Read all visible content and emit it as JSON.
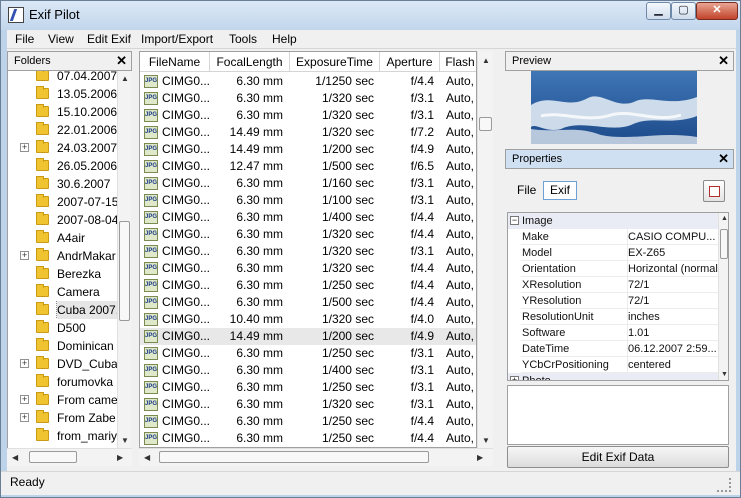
{
  "window": {
    "title": "Exif Pilot",
    "controls": [
      "minimize",
      "maximize",
      "close"
    ]
  },
  "menu": [
    {
      "label": "File"
    },
    {
      "label": "View"
    },
    {
      "label": "Edit Exif"
    },
    {
      "label": "Import/Export"
    },
    {
      "label": "Tools"
    },
    {
      "label": "Help"
    }
  ],
  "folders": {
    "title": "Folders",
    "close_label": "✕",
    "items": [
      {
        "label": "07.04.2007",
        "expander": false
      },
      {
        "label": "13.05.2006",
        "expander": false
      },
      {
        "label": "15.10.2006",
        "expander": false
      },
      {
        "label": "22.01.2006",
        "expander": false
      },
      {
        "label": "24.03.2007",
        "expander": true
      },
      {
        "label": "26.05.2006",
        "expander": false
      },
      {
        "label": "30.6.2007",
        "expander": false
      },
      {
        "label": "2007-07-15",
        "expander": false
      },
      {
        "label": "2007-08-04",
        "expander": false
      },
      {
        "label": "A4air",
        "expander": false
      },
      {
        "label": "AndrMakar",
        "expander": true
      },
      {
        "label": "Berezka",
        "expander": false
      },
      {
        "label": "Camera",
        "expander": false
      },
      {
        "label": "Cuba 2007.",
        "expander": false,
        "selected": true
      },
      {
        "label": "D500",
        "expander": false
      },
      {
        "label": "Dominican",
        "expander": false
      },
      {
        "label": "DVD_Cuba_",
        "expander": true
      },
      {
        "label": "forumovka",
        "expander": false
      },
      {
        "label": "From came",
        "expander": true
      },
      {
        "label": "From Zabe",
        "expander": true
      },
      {
        "label": "from_mariy",
        "expander": false
      }
    ]
  },
  "files": {
    "columns": [
      "FileName",
      "FocalLength",
      "ExposureTime",
      "Aperture",
      "Flash"
    ],
    "rows": [
      {
        "name": "CIMG0...",
        "focal": "6.30 mm",
        "exposure": "1/1250 sec",
        "aperture": "f/4.4",
        "flash": "Auto,"
      },
      {
        "name": "CIMG0...",
        "focal": "6.30 mm",
        "exposure": "1/320 sec",
        "aperture": "f/3.1",
        "flash": "Auto,"
      },
      {
        "name": "CIMG0...",
        "focal": "6.30 mm",
        "exposure": "1/320 sec",
        "aperture": "f/3.1",
        "flash": "Auto,"
      },
      {
        "name": "CIMG0...",
        "focal": "14.49 mm",
        "exposure": "1/320 sec",
        "aperture": "f/7.2",
        "flash": "Auto,"
      },
      {
        "name": "CIMG0...",
        "focal": "14.49 mm",
        "exposure": "1/200 sec",
        "aperture": "f/4.9",
        "flash": "Auto,"
      },
      {
        "name": "CIMG0...",
        "focal": "12.47 mm",
        "exposure": "1/500 sec",
        "aperture": "f/6.5",
        "flash": "Auto,"
      },
      {
        "name": "CIMG0...",
        "focal": "6.30 mm",
        "exposure": "1/160 sec",
        "aperture": "f/3.1",
        "flash": "Auto,"
      },
      {
        "name": "CIMG0...",
        "focal": "6.30 mm",
        "exposure": "1/100 sec",
        "aperture": "f/3.1",
        "flash": "Auto,"
      },
      {
        "name": "CIMG0...",
        "focal": "6.30 mm",
        "exposure": "1/400 sec",
        "aperture": "f/4.4",
        "flash": "Auto,"
      },
      {
        "name": "CIMG0...",
        "focal": "6.30 mm",
        "exposure": "1/320 sec",
        "aperture": "f/4.4",
        "flash": "Auto,"
      },
      {
        "name": "CIMG0...",
        "focal": "6.30 mm",
        "exposure": "1/320 sec",
        "aperture": "f/3.1",
        "flash": "Auto,"
      },
      {
        "name": "CIMG0...",
        "focal": "6.30 mm",
        "exposure": "1/320 sec",
        "aperture": "f/4.4",
        "flash": "Auto,"
      },
      {
        "name": "CIMG0...",
        "focal": "6.30 mm",
        "exposure": "1/250 sec",
        "aperture": "f/4.4",
        "flash": "Auto,"
      },
      {
        "name": "CIMG0...",
        "focal": "6.30 mm",
        "exposure": "1/500 sec",
        "aperture": "f/4.4",
        "flash": "Auto,"
      },
      {
        "name": "CIMG0...",
        "focal": "10.40 mm",
        "exposure": "1/320 sec",
        "aperture": "f/4.0",
        "flash": "Auto,"
      },
      {
        "name": "CIMG0...",
        "focal": "14.49 mm",
        "exposure": "1/200 sec",
        "aperture": "f/4.9",
        "flash": "Auto,",
        "selected": true
      },
      {
        "name": "CIMG0...",
        "focal": "6.30 mm",
        "exposure": "1/250 sec",
        "aperture": "f/3.1",
        "flash": "Auto,"
      },
      {
        "name": "CIMG0...",
        "focal": "6.30 mm",
        "exposure": "1/400 sec",
        "aperture": "f/3.1",
        "flash": "Auto,"
      },
      {
        "name": "CIMG0...",
        "focal": "6.30 mm",
        "exposure": "1/250 sec",
        "aperture": "f/3.1",
        "flash": "Auto,"
      },
      {
        "name": "CIMG0...",
        "focal": "6.30 mm",
        "exposure": "1/320 sec",
        "aperture": "f/3.1",
        "flash": "Auto,"
      },
      {
        "name": "CIMG0...",
        "focal": "6.30 mm",
        "exposure": "1/250 sec",
        "aperture": "f/4.4",
        "flash": "Auto,"
      },
      {
        "name": "CIMG0...",
        "focal": "6.30 mm",
        "exposure": "1/250 sec",
        "aperture": "f/4.4",
        "flash": "Auto,"
      }
    ]
  },
  "preview": {
    "title": "Preview",
    "close_label": "✕"
  },
  "properties": {
    "title": "Properties",
    "close_label": "✕",
    "file_label": "File",
    "tab_label": "Exif",
    "groups": [
      "Image",
      "Photo"
    ],
    "rows": [
      {
        "name": "Make",
        "value": "CASIO COMPU..."
      },
      {
        "name": "Model",
        "value": "EX-Z65"
      },
      {
        "name": "Orientation",
        "value": "Horizontal (normal)"
      },
      {
        "name": "XResolution",
        "value": "72/1"
      },
      {
        "name": "YResolution",
        "value": "72/1"
      },
      {
        "name": "ResolutionUnit",
        "value": "inches"
      },
      {
        "name": "Software",
        "value": "1.01"
      },
      {
        "name": "DateTime",
        "value": "06.12.2007 2:59..."
      },
      {
        "name": "YCbCrPositioning",
        "value": "centered"
      }
    ],
    "edit_button": "Edit Exif Data"
  },
  "status": {
    "text": "Ready"
  }
}
